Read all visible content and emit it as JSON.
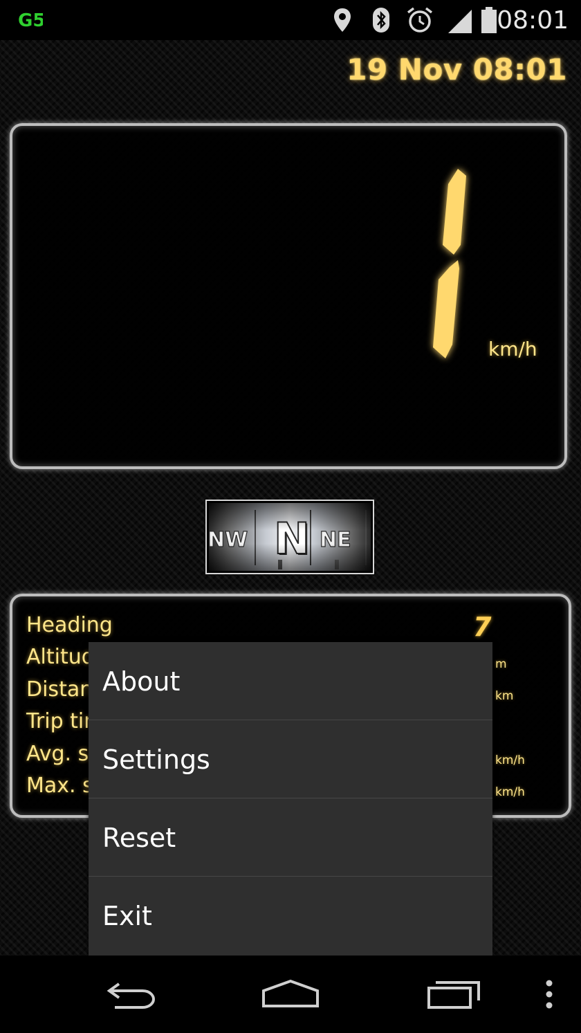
{
  "status_bar": {
    "time": "08:01",
    "icons": [
      "app-logo-icon",
      "location-icon",
      "bluetooth-icon",
      "alarm-icon",
      "signal-icon",
      "battery-icon"
    ],
    "logo_text": "G5"
  },
  "dashboard": {
    "datetime": "19 Nov 08:01",
    "speed": {
      "value": "1",
      "unit": "km/h"
    },
    "compass": {
      "left": "NW",
      "center": "N",
      "right": "NE"
    },
    "info": {
      "rows": [
        {
          "label": "Heading",
          "unit": ""
        },
        {
          "label": "Altitude",
          "unit": "m"
        },
        {
          "label": "Distance",
          "unit": "km"
        },
        {
          "label": "Trip time",
          "unit": ""
        },
        {
          "label": "Avg. speed",
          "unit": "km/h"
        },
        {
          "label": "Max. speed",
          "unit": "km/h"
        }
      ],
      "heading_value": "7"
    }
  },
  "menu": {
    "items": [
      "About",
      "Settings",
      "Reset",
      "Exit"
    ]
  },
  "nav_bar": {
    "icons": [
      "back-icon",
      "home-icon",
      "recents-icon",
      "overflow-menu-icon"
    ]
  },
  "colors": {
    "accent_yellow": "#ffe68a",
    "menu_bg": "#2f2f2f",
    "logo_green": "#2fd02f"
  }
}
